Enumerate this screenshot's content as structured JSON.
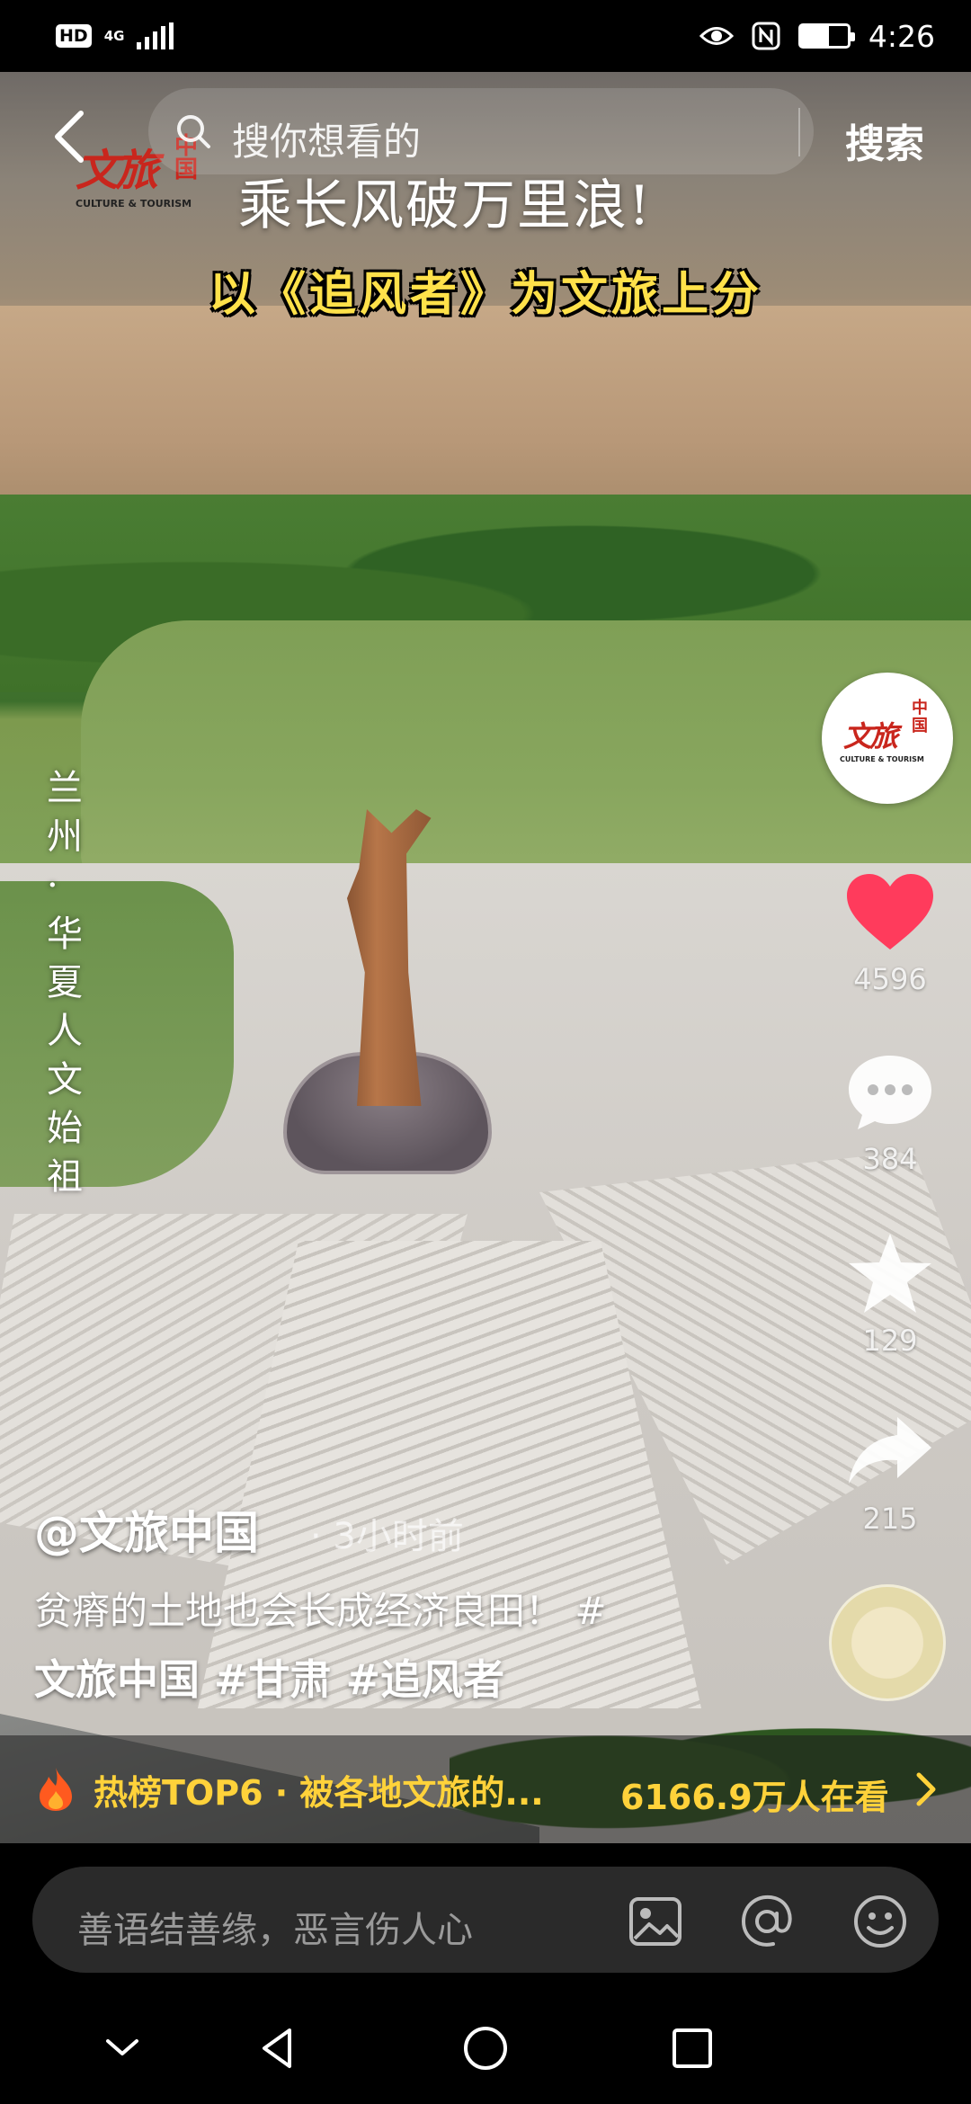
{
  "status_bar": {
    "hd": "HD",
    "network": "4G",
    "time": "4:26"
  },
  "search": {
    "placeholder": "搜你想看的",
    "button": "搜索"
  },
  "video": {
    "logo_zh": "文旅",
    "logo_vertical": "中国",
    "logo_en": "CULTURE & TOURISM",
    "headline": "乘长风破万里浪!",
    "subhead": "以《追风者》为文旅上分",
    "vertical_caption": "兰州·华夏人文始祖"
  },
  "actions": {
    "likes": "4596",
    "comments": "384",
    "favorites": "129",
    "shares": "215"
  },
  "post": {
    "author": "@文旅中国",
    "time": "· 3小时前",
    "desc_line1": "贫瘠的土地也会长成经济良田！ #",
    "desc_line2": "文旅中国 #甘肃 #追风者"
  },
  "trending": {
    "text": "热榜TOP6 · 被各地文旅的...",
    "viewers": "6166.9万人在看"
  },
  "comment_bar": {
    "placeholder": "善语结善缘，恶言伤人心"
  },
  "colors": {
    "like": "#ff3b5c",
    "trend": "#ffd23a",
    "subhead": "#ffe14a",
    "logo_red": "#c9261d"
  },
  "icons": [
    "back-icon",
    "search-icon",
    "heart-icon",
    "comment-icon",
    "star-icon",
    "share-icon",
    "flame-icon",
    "chevron-right-icon",
    "image-icon",
    "at-icon",
    "emoji-icon",
    "nav-back-icon",
    "nav-home-icon",
    "nav-recents-icon",
    "nav-collapse-icon"
  ]
}
